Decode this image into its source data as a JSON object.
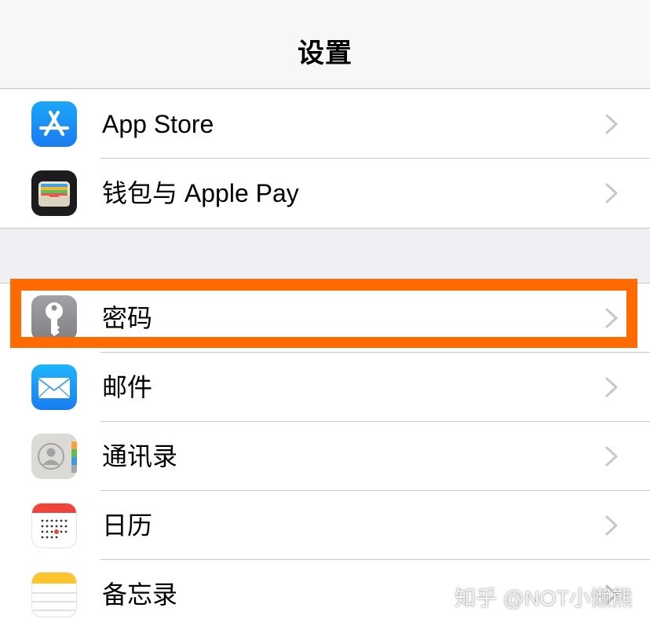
{
  "navbar": {
    "title": "设置"
  },
  "group1": {
    "items": [
      {
        "label": "App Store"
      },
      {
        "label": "钱包与 Apple Pay"
      }
    ]
  },
  "group2": {
    "items": [
      {
        "label": "密码"
      },
      {
        "label": "邮件"
      },
      {
        "label": "通讯录"
      },
      {
        "label": "日历"
      },
      {
        "label": "备忘录"
      }
    ]
  },
  "annotation": {
    "highlight_color": "#ff6b00",
    "highlighted_item": "密码"
  },
  "watermark": {
    "text": "知乎 @NOT小懒熊"
  },
  "colors": {
    "background": "#efeff4",
    "separator": "#c8c7cc",
    "chevron": "#c7c7cc"
  }
}
